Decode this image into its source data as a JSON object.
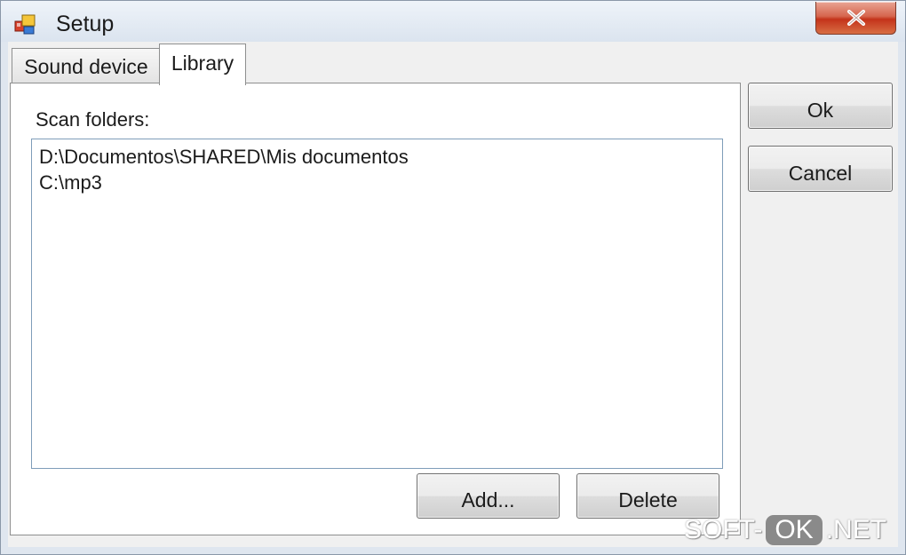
{
  "window": {
    "title": "Setup",
    "icon": "app-icon",
    "close_icon": "close-icon"
  },
  "tabs": [
    {
      "label": "Sound device",
      "active": false
    },
    {
      "label": "Library",
      "active": true
    }
  ],
  "library": {
    "scan_label": "Scan folders:",
    "folders": [
      "D:\\Documentos\\SHARED\\Mis documentos",
      "C:\\mp3"
    ],
    "add_label": "Add...",
    "delete_label": "Delete"
  },
  "dialog_buttons": {
    "ok_label": "Ok",
    "cancel_label": "Cancel"
  },
  "watermark": {
    "part1": "SOFT-",
    "part2": "OK",
    "part3": ".NET"
  },
  "colors": {
    "close_button": "#c4331a",
    "list_border": "#7f9db9"
  }
}
